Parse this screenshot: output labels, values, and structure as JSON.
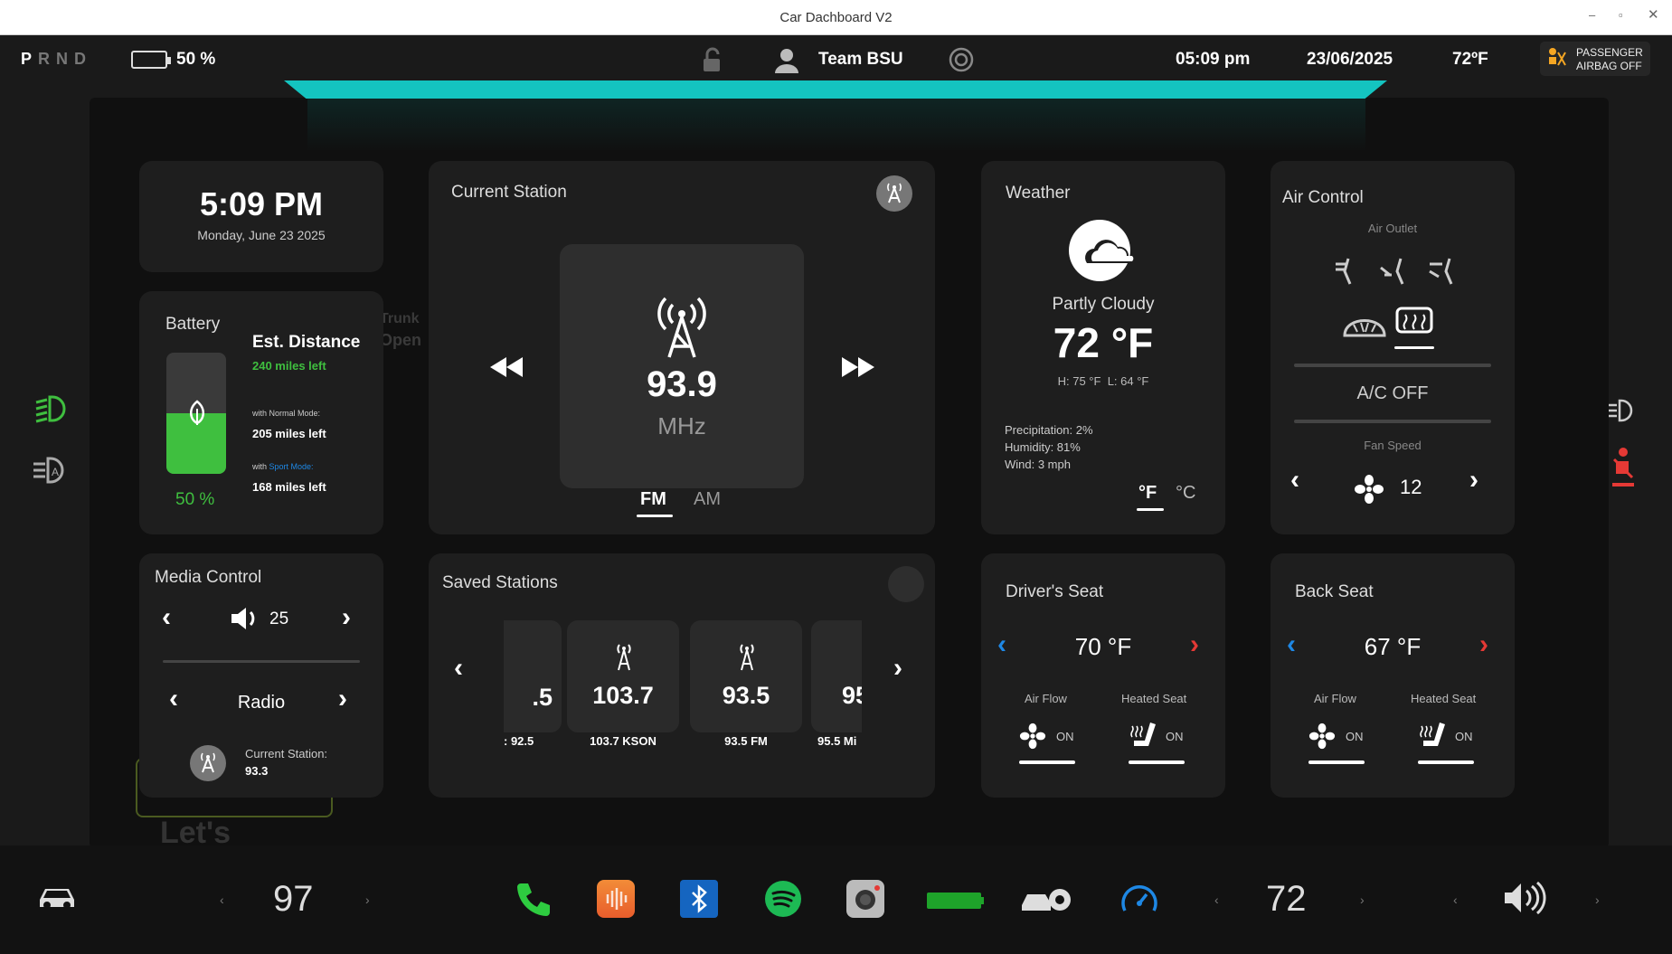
{
  "window": {
    "title": "Car Dachboard V2"
  },
  "status": {
    "gear": "PRND",
    "battery_pct": "50 %",
    "user": "Team BSU",
    "time": "05:09 pm",
    "date": "23/06/2025",
    "temp": "72ºF",
    "airbag_line1": "PASSENGER",
    "airbag_line2": "AIRBAG OFF"
  },
  "clock": {
    "time": "5:09 PM",
    "date": "Monday, June 23 2025"
  },
  "battery": {
    "title": "Battery",
    "est_title": "Est. Distance",
    "est_value": "240 miles left",
    "normal_with": "with",
    "normal_mode": "Normal Mode:",
    "normal_value": "205 miles left",
    "sport_with": "with",
    "sport_mode": "Sport Mode:",
    "sport_value": "168 miles left",
    "pct": "50 %",
    "level": 0.5
  },
  "media": {
    "title": "Media Control",
    "volume": "25",
    "source": "Radio",
    "station_label": "Current Station:",
    "station_value": "93.3"
  },
  "radio": {
    "title": "Current Station",
    "freq": "93.9",
    "unit": "MHz",
    "band_fm": "FM",
    "band_am": "AM"
  },
  "saved": {
    "title": "Saved Stations",
    "stations": [
      {
        "freq": ".5",
        "name": ": 92.5"
      },
      {
        "freq": "103.7",
        "name": "103.7 KSON"
      },
      {
        "freq": "93.5",
        "name": "93.5 FM"
      },
      {
        "freq": "95",
        "name": "95.5 Mi"
      }
    ]
  },
  "weather": {
    "title": "Weather",
    "condition": "Partly Cloudy",
    "temp": "72 °F",
    "high": "H: 75 °F",
    "low": "L: 64 °F",
    "precip": "Precipitation: 2%",
    "humidity": "Humidity: 81%",
    "wind": "Wind: 3 mph",
    "unit_f": "°F",
    "unit_c": "°C"
  },
  "air": {
    "title": "Air Control",
    "outlet_label": "Air Outlet",
    "ac": "A/C OFF",
    "fan_label": "Fan Speed",
    "fan_speed": "12"
  },
  "driver_seat": {
    "title": "Driver's Seat",
    "temp": "70 °F",
    "airflow": "Air Flow",
    "heated": "Heated Seat",
    "airflow_state": "ON",
    "heated_state": "ON"
  },
  "back_seat": {
    "title": "Back Seat",
    "temp": "67 °F",
    "airflow": "Air Flow",
    "heated": "Heated Seat",
    "airflow_state": "ON",
    "heated_state": "ON"
  },
  "bg_text": {
    "trunk": "Trunk",
    "open": "Open",
    "lets": "Let's"
  },
  "dock": {
    "left_temp": "97",
    "right_temp": "72"
  },
  "colors": {
    "accent": "#14c4c0",
    "green": "#3fbf3f",
    "blue": "#1e88e5",
    "red": "#e53935"
  }
}
